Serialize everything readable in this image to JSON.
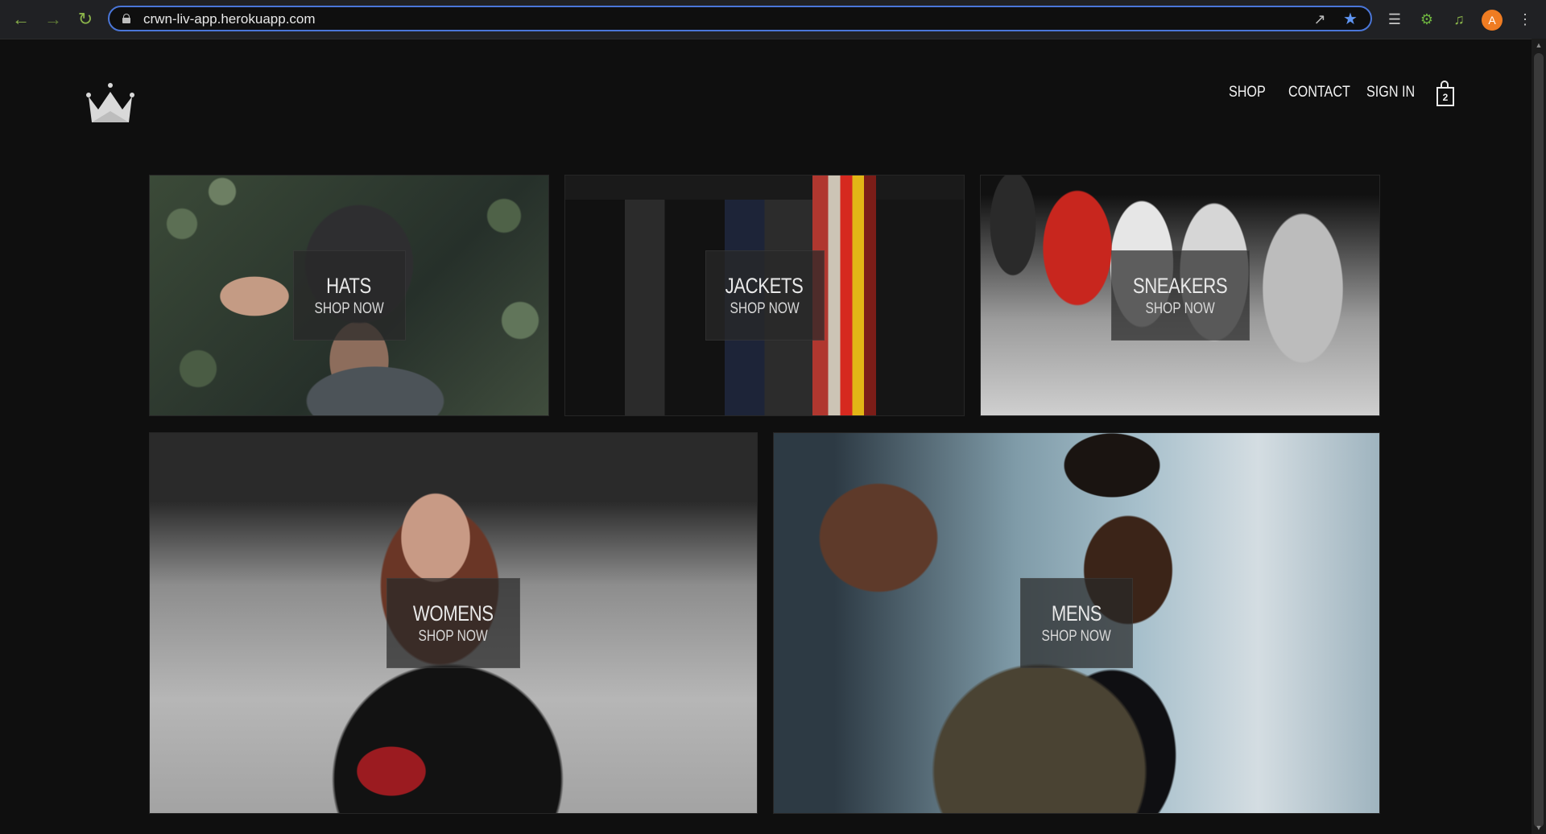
{
  "browser": {
    "url": "crwn-liv-app.herokuapp.com",
    "avatar_letter": "A",
    "accent_color": "#4a76d8",
    "icons": [
      "back-arrow-icon",
      "forward-arrow-icon",
      "reload-icon",
      "lock-icon",
      "share-icon",
      "star-icon",
      "reading-list-icon",
      "extensions-icon",
      "media-icon",
      "kebab-menu-icon"
    ]
  },
  "header": {
    "logo_icon": "crown-icon",
    "links": {
      "shop": "SHOP",
      "contact": "CONTACT",
      "sign_in": "SIGN IN"
    },
    "cart": {
      "icon": "shopping-bag-icon",
      "count": "2"
    }
  },
  "directory": {
    "sections": [
      {
        "title": "HATS",
        "subtitle": "SHOP NOW"
      },
      {
        "title": "JACKETS",
        "subtitle": "SHOP NOW"
      },
      {
        "title": "SNEAKERS",
        "subtitle": "SHOP NOW"
      },
      {
        "title": "WOMENS",
        "subtitle": "SHOP NOW"
      },
      {
        "title": "MENS",
        "subtitle": "SHOP NOW"
      }
    ]
  }
}
